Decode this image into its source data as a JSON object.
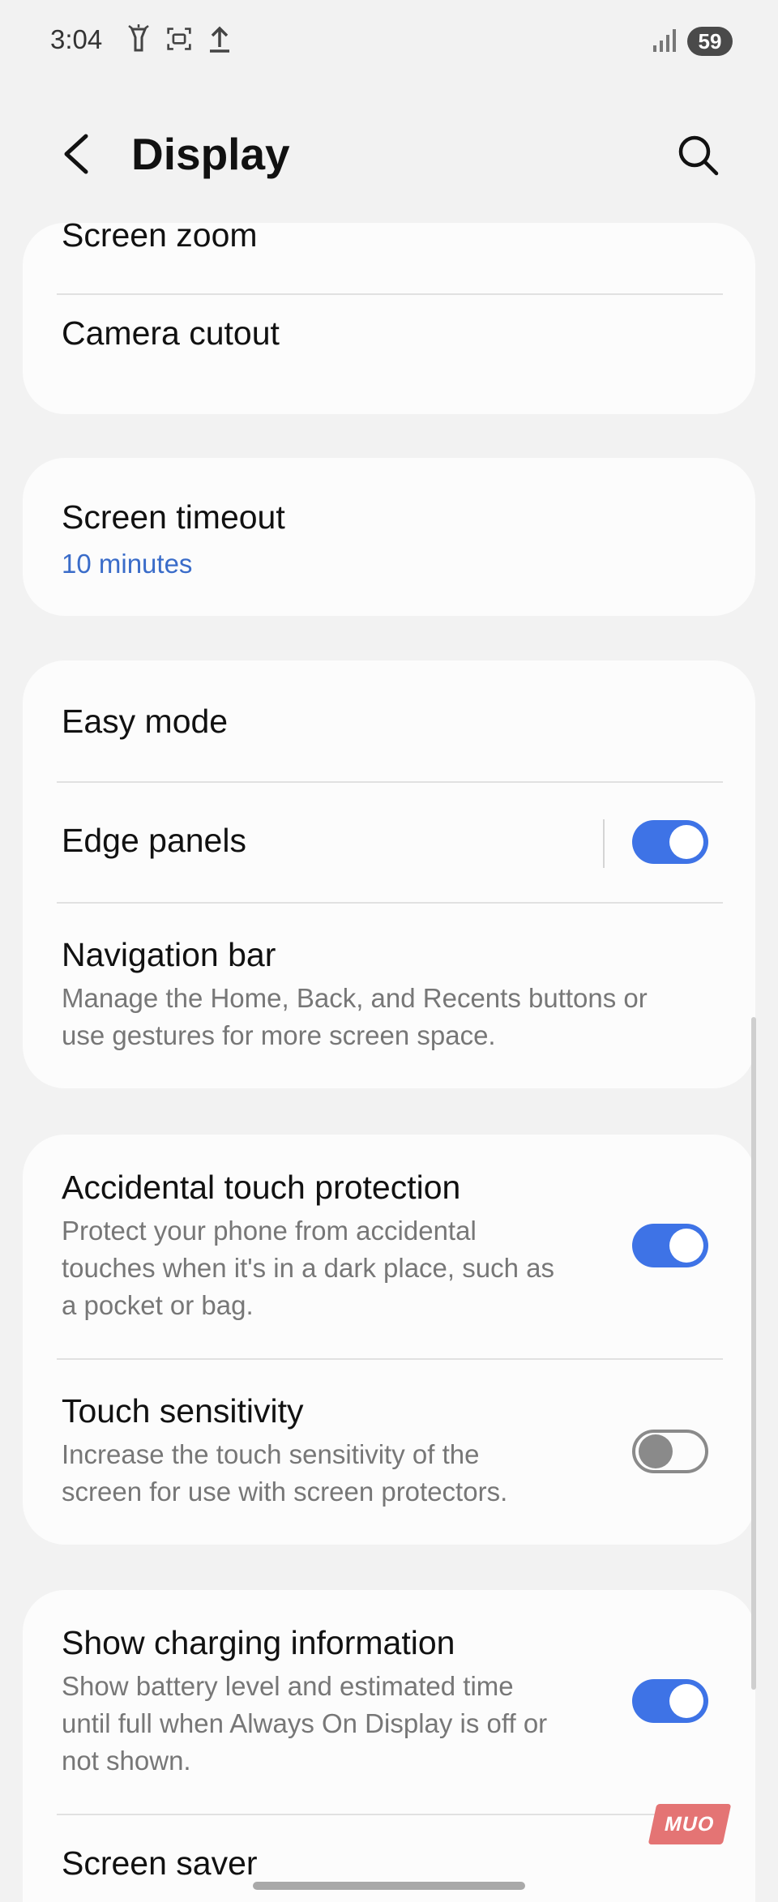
{
  "status_bar": {
    "time": "3:04",
    "battery": "59",
    "icons": [
      "flashlight-icon",
      "screenshot-icon",
      "upload-icon",
      "signal-icon"
    ]
  },
  "header": {
    "title": "Display",
    "back_icon": "chevron-left-icon",
    "search_icon": "search-icon"
  },
  "groups": {
    "g1": {
      "screen_zoom": "Screen zoom",
      "camera_cutout": "Camera cutout"
    },
    "g2": {
      "screen_timeout": "Screen timeout",
      "screen_timeout_value": "10 minutes"
    },
    "g3": {
      "easy_mode": "Easy mode",
      "edge_panels": "Edge panels",
      "edge_panels_on": true,
      "navigation_bar": "Navigation bar",
      "navigation_bar_desc_1": "Manage the Home, Back, and Recents buttons or",
      "navigation_bar_desc_2": "use gestures for more screen space."
    },
    "g4": {
      "accidental_touch": "Accidental touch protection",
      "accidental_touch_desc_1": "Protect your phone from accidental",
      "accidental_touch_desc_2": "touches when it's in a dark place, such as",
      "accidental_touch_desc_3": "a pocket or bag.",
      "accidental_touch_on": true,
      "touch_sensitivity": "Touch sensitivity",
      "touch_sensitivity_desc_1": "Increase the touch sensitivity of the",
      "touch_sensitivity_desc_2": "screen for use with screen protectors.",
      "touch_sensitivity_on": false
    },
    "g5": {
      "show_charging": "Show charging information",
      "show_charging_desc_1": "Show battery level and estimated time",
      "show_charging_desc_2": "until full when Always On Display is off or",
      "show_charging_desc_3": "not shown.",
      "show_charging_on": true,
      "screen_saver": "Screen saver"
    }
  },
  "watermark": "MUO",
  "colors": {
    "accent": "#3e73e6",
    "link": "#3a6cc9",
    "background": "#f2f2f2",
    "card": "#fcfcfc"
  }
}
